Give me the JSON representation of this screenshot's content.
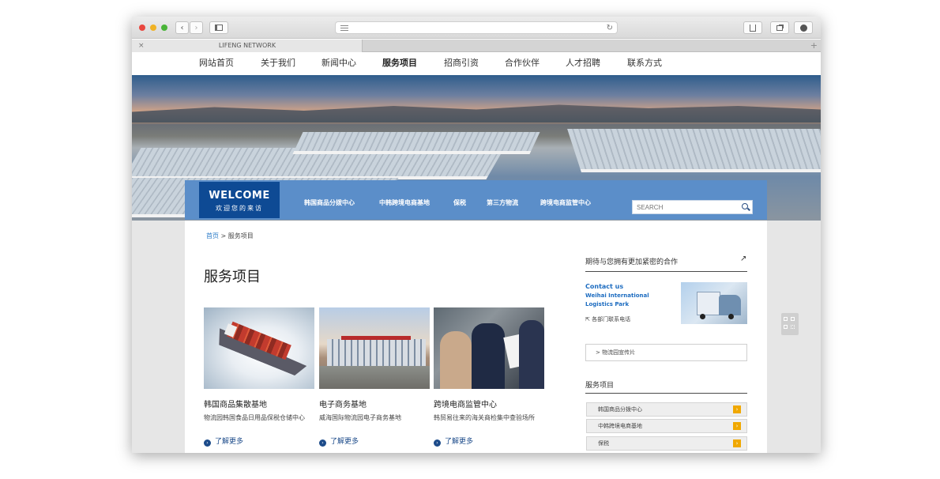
{
  "browser": {
    "tab_close": "×",
    "tab_title": "LIFENG NETWORK",
    "tab_new": "+"
  },
  "nav": {
    "items": [
      "网站首页",
      "关于我们",
      "新闻中心",
      "服务项目",
      "招商引资",
      "合作伙伴",
      "人才招聘",
      "联系方式"
    ],
    "active": "服务项目"
  },
  "welcome": {
    "title": "WELCOME",
    "subtitle": "欢迎您的来访"
  },
  "subnav": {
    "items": [
      "韩国商品分拨中心",
      "中韩跨境电商基地",
      "保税",
      "第三方物流",
      "跨境电商监管中心"
    ]
  },
  "search": {
    "placeholder": "SEARCH"
  },
  "breadcrumb": {
    "home": "首页",
    "separator": ">",
    "current": "服务项目"
  },
  "page_title": "服务项目",
  "cards": [
    {
      "name": "韩国商品集散基地",
      "desc": "物流园韩国食品日用品保税仓储中心",
      "more": "了解更多"
    },
    {
      "name": "电子商务基地",
      "desc": "威海国际物流园电子商务基地",
      "more": "了解更多"
    },
    {
      "name": "跨境电商监管中心",
      "desc": "韩贸易往来的海关商检集中查验场所",
      "more": "了解更多"
    }
  ],
  "sidebar": {
    "contact_heading": "期待与您拥有更加紧密的合作",
    "contact_title": "Contact us",
    "contact_company": "Weihai International Logistics Park",
    "contact_link": "各部门联系电话",
    "video_link": "物流园宣传片",
    "services_heading": "服务项目",
    "services": [
      "韩国商品分拨中心",
      "中韩跨境电商基地",
      "保税"
    ]
  },
  "colors": {
    "band": "#5b8ec9",
    "welcome_bg": "#0e4a94",
    "link_blue": "#1d6cc0",
    "arrow_orange": "#f0a800"
  }
}
